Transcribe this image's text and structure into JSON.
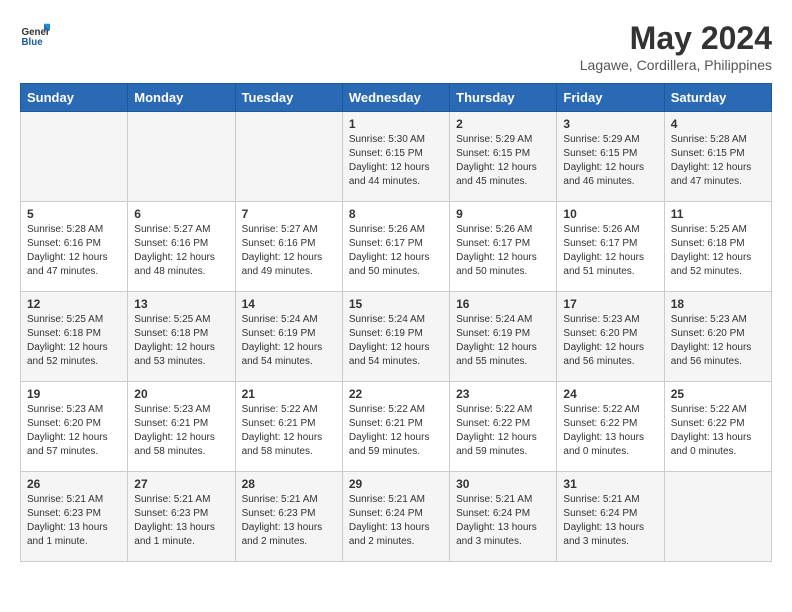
{
  "header": {
    "logo_line1": "General",
    "logo_line2": "Blue",
    "month_year": "May 2024",
    "location": "Lagawe, Cordillera, Philippines"
  },
  "days_of_week": [
    "Sunday",
    "Monday",
    "Tuesday",
    "Wednesday",
    "Thursday",
    "Friday",
    "Saturday"
  ],
  "weeks": [
    [
      {
        "day": "",
        "info": ""
      },
      {
        "day": "",
        "info": ""
      },
      {
        "day": "",
        "info": ""
      },
      {
        "day": "1",
        "info": "Sunrise: 5:30 AM\nSunset: 6:15 PM\nDaylight: 12 hours\nand 44 minutes."
      },
      {
        "day": "2",
        "info": "Sunrise: 5:29 AM\nSunset: 6:15 PM\nDaylight: 12 hours\nand 45 minutes."
      },
      {
        "day": "3",
        "info": "Sunrise: 5:29 AM\nSunset: 6:15 PM\nDaylight: 12 hours\nand 46 minutes."
      },
      {
        "day": "4",
        "info": "Sunrise: 5:28 AM\nSunset: 6:15 PM\nDaylight: 12 hours\nand 47 minutes."
      }
    ],
    [
      {
        "day": "5",
        "info": "Sunrise: 5:28 AM\nSunset: 6:16 PM\nDaylight: 12 hours\nand 47 minutes."
      },
      {
        "day": "6",
        "info": "Sunrise: 5:27 AM\nSunset: 6:16 PM\nDaylight: 12 hours\nand 48 minutes."
      },
      {
        "day": "7",
        "info": "Sunrise: 5:27 AM\nSunset: 6:16 PM\nDaylight: 12 hours\nand 49 minutes."
      },
      {
        "day": "8",
        "info": "Sunrise: 5:26 AM\nSunset: 6:17 PM\nDaylight: 12 hours\nand 50 minutes."
      },
      {
        "day": "9",
        "info": "Sunrise: 5:26 AM\nSunset: 6:17 PM\nDaylight: 12 hours\nand 50 minutes."
      },
      {
        "day": "10",
        "info": "Sunrise: 5:26 AM\nSunset: 6:17 PM\nDaylight: 12 hours\nand 51 minutes."
      },
      {
        "day": "11",
        "info": "Sunrise: 5:25 AM\nSunset: 6:18 PM\nDaylight: 12 hours\nand 52 minutes."
      }
    ],
    [
      {
        "day": "12",
        "info": "Sunrise: 5:25 AM\nSunset: 6:18 PM\nDaylight: 12 hours\nand 52 minutes."
      },
      {
        "day": "13",
        "info": "Sunrise: 5:25 AM\nSunset: 6:18 PM\nDaylight: 12 hours\nand 53 minutes."
      },
      {
        "day": "14",
        "info": "Sunrise: 5:24 AM\nSunset: 6:19 PM\nDaylight: 12 hours\nand 54 minutes."
      },
      {
        "day": "15",
        "info": "Sunrise: 5:24 AM\nSunset: 6:19 PM\nDaylight: 12 hours\nand 54 minutes."
      },
      {
        "day": "16",
        "info": "Sunrise: 5:24 AM\nSunset: 6:19 PM\nDaylight: 12 hours\nand 55 minutes."
      },
      {
        "day": "17",
        "info": "Sunrise: 5:23 AM\nSunset: 6:20 PM\nDaylight: 12 hours\nand 56 minutes."
      },
      {
        "day": "18",
        "info": "Sunrise: 5:23 AM\nSunset: 6:20 PM\nDaylight: 12 hours\nand 56 minutes."
      }
    ],
    [
      {
        "day": "19",
        "info": "Sunrise: 5:23 AM\nSunset: 6:20 PM\nDaylight: 12 hours\nand 57 minutes."
      },
      {
        "day": "20",
        "info": "Sunrise: 5:23 AM\nSunset: 6:21 PM\nDaylight: 12 hours\nand 58 minutes."
      },
      {
        "day": "21",
        "info": "Sunrise: 5:22 AM\nSunset: 6:21 PM\nDaylight: 12 hours\nand 58 minutes."
      },
      {
        "day": "22",
        "info": "Sunrise: 5:22 AM\nSunset: 6:21 PM\nDaylight: 12 hours\nand 59 minutes."
      },
      {
        "day": "23",
        "info": "Sunrise: 5:22 AM\nSunset: 6:22 PM\nDaylight: 12 hours\nand 59 minutes."
      },
      {
        "day": "24",
        "info": "Sunrise: 5:22 AM\nSunset: 6:22 PM\nDaylight: 13 hours\nand 0 minutes."
      },
      {
        "day": "25",
        "info": "Sunrise: 5:22 AM\nSunset: 6:22 PM\nDaylight: 13 hours\nand 0 minutes."
      }
    ],
    [
      {
        "day": "26",
        "info": "Sunrise: 5:21 AM\nSunset: 6:23 PM\nDaylight: 13 hours\nand 1 minute."
      },
      {
        "day": "27",
        "info": "Sunrise: 5:21 AM\nSunset: 6:23 PM\nDaylight: 13 hours\nand 1 minute."
      },
      {
        "day": "28",
        "info": "Sunrise: 5:21 AM\nSunset: 6:23 PM\nDaylight: 13 hours\nand 2 minutes."
      },
      {
        "day": "29",
        "info": "Sunrise: 5:21 AM\nSunset: 6:24 PM\nDaylight: 13 hours\nand 2 minutes."
      },
      {
        "day": "30",
        "info": "Sunrise: 5:21 AM\nSunset: 6:24 PM\nDaylight: 13 hours\nand 3 minutes."
      },
      {
        "day": "31",
        "info": "Sunrise: 5:21 AM\nSunset: 6:24 PM\nDaylight: 13 hours\nand 3 minutes."
      },
      {
        "day": "",
        "info": ""
      }
    ]
  ]
}
